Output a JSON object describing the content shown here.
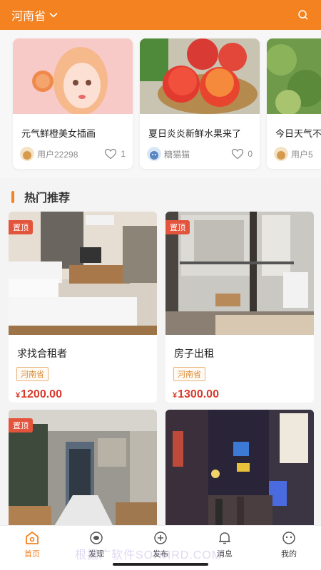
{
  "header": {
    "region": "河南省"
  },
  "featured": [
    {
      "title": "元气鲜橙美女插画",
      "user": "用户22298",
      "likes": "1"
    },
    {
      "title": "夏日炎炎新鲜水果来了",
      "user": "糖猫猫",
      "likes": "0"
    },
    {
      "title": "今日天气不",
      "user": "用户5"
    }
  ],
  "section": {
    "title": "热门推荐"
  },
  "listings": [
    {
      "badge": "置顶",
      "name": "求找合租者",
      "tag": "河南省",
      "currency": "¥",
      "price": "1200.00"
    },
    {
      "badge": "置顶",
      "name": "房子出租",
      "tag": "河南省",
      "currency": "¥",
      "price": "1300.00"
    },
    {
      "badge": "置顶"
    }
  ],
  "nav": [
    {
      "label": "首页",
      "icon": "home-icon"
    },
    {
      "label": "发现",
      "icon": "eye-icon"
    },
    {
      "label": "发布",
      "icon": "plus-circle-icon"
    },
    {
      "label": "消息",
      "icon": "bell-icon"
    },
    {
      "label": "我的",
      "icon": "face-icon"
    }
  ],
  "watermark": "根据广软件SOHHRD.COM",
  "colors": {
    "accent": "#f58220",
    "price": "#d83a2c",
    "badge": "#e3543c"
  }
}
